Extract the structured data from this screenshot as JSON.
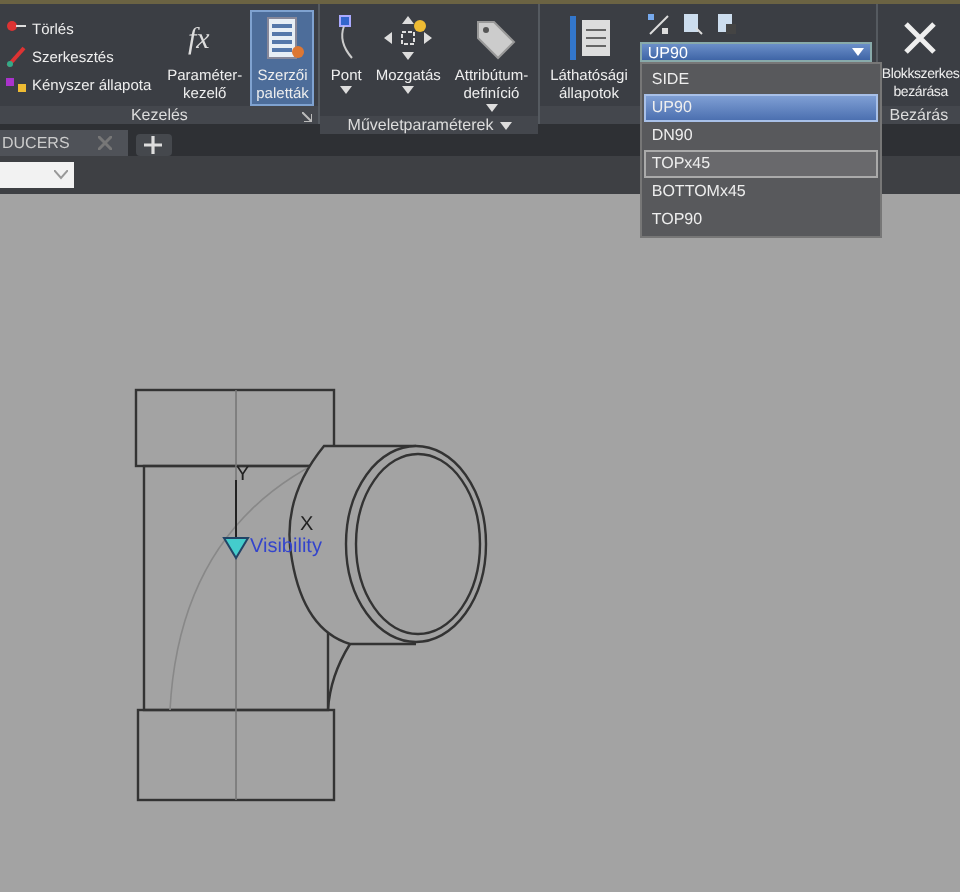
{
  "ribbon": {
    "panels": [
      {
        "title": "Kezelés",
        "launcher": true,
        "small_buttons": [
          "Törlés",
          "Szerkesztés",
          "Kényszer állapota"
        ],
        "large_buttons": [
          {
            "label": "Paraméter-\nkezelő",
            "selected": false,
            "menu": false,
            "icon_text": "fx"
          },
          {
            "label": "Szerzői\npaletták",
            "selected": true,
            "menu": false
          }
        ]
      },
      {
        "title": "Műveletparaméterek",
        "title_menu": true,
        "large_buttons": [
          {
            "label": "Pont",
            "selected": false,
            "menu": true
          },
          {
            "label": "Mozgatás",
            "selected": false,
            "menu": true
          },
          {
            "label": "Attribútum-\ndefiníció",
            "selected": false,
            "menu": true
          }
        ]
      },
      {
        "large_buttons": [
          {
            "label": "Láthatósági\nállapotok",
            "selected": false,
            "menu": false
          }
        ],
        "visibility_dropdown": {
          "value": "UP90",
          "expanded": true,
          "options": [
            {
              "label": "SIDE",
              "selected": false,
              "highlighted": false
            },
            {
              "label": "UP90",
              "selected": true,
              "highlighted": false
            },
            {
              "label": "DN90",
              "selected": false,
              "highlighted": false
            },
            {
              "label": "TOPx45",
              "selected": false,
              "highlighted": true
            },
            {
              "label": "BOTTOMx45",
              "selected": false,
              "highlighted": false
            },
            {
              "label": "TOP90",
              "selected": false,
              "highlighted": false
            }
          ]
        }
      },
      {
        "title": "Bezárás",
        "large_buttons": [
          {
            "label": "Blokkszerkes\nbezárása",
            "selected": false,
            "menu": false
          }
        ]
      }
    ]
  },
  "file_tabs": [
    {
      "label": "DUCERS",
      "selected": true
    }
  ],
  "drawing": {
    "axis_y": "Y",
    "axis_x": "X",
    "parameter_label": "Visibility"
  }
}
